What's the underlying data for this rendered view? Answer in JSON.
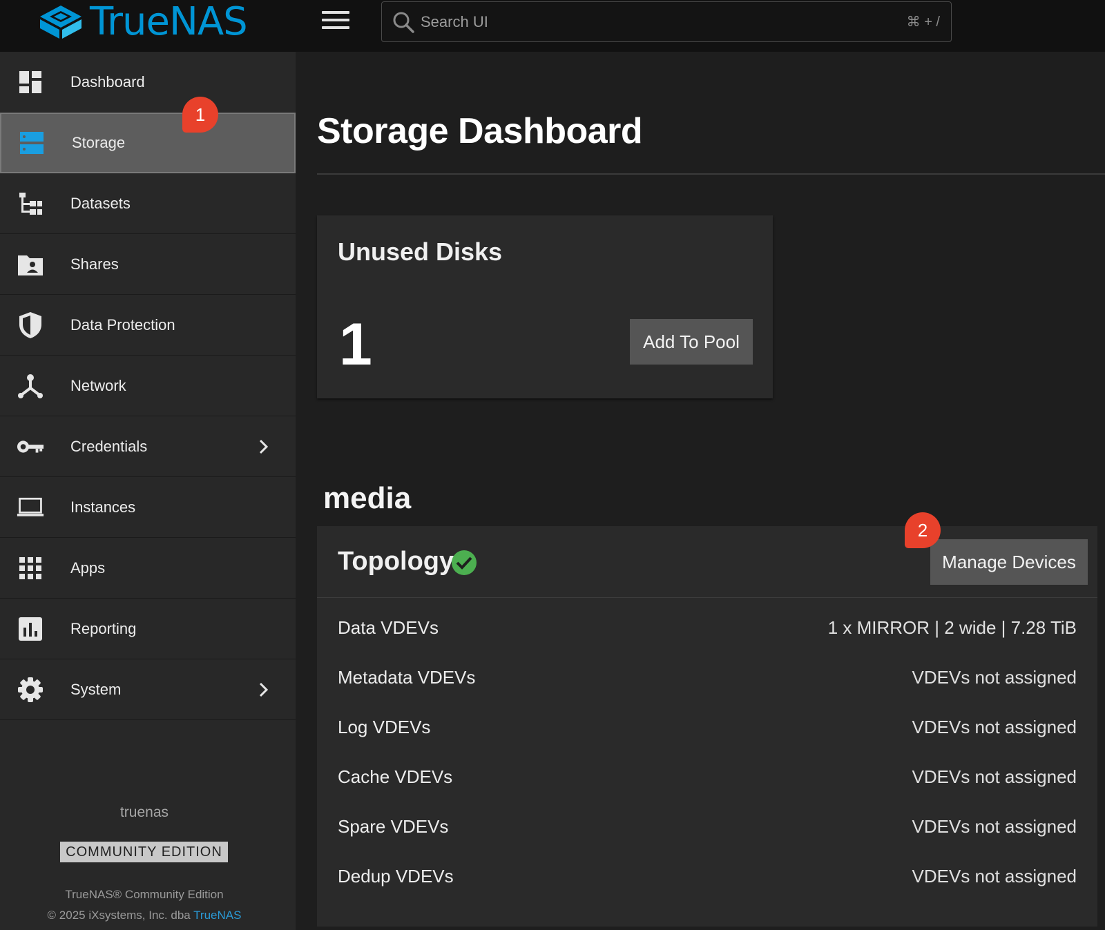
{
  "app": {
    "logo_text": "TrueNAS",
    "brand_color": "#0095d5"
  },
  "search": {
    "placeholder": "Search UI",
    "shortcut": "⌘ + /"
  },
  "sidebar": {
    "items": [
      {
        "label": "Dashboard",
        "icon": "dashboard-icon",
        "active": false
      },
      {
        "label": "Storage",
        "icon": "storage-icon",
        "active": true
      },
      {
        "label": "Datasets",
        "icon": "datasets-icon",
        "active": false
      },
      {
        "label": "Shares",
        "icon": "shares-folder-icon",
        "active": false
      },
      {
        "label": "Data Protection",
        "icon": "shield-icon",
        "active": false
      },
      {
        "label": "Network",
        "icon": "network-icon",
        "active": false
      },
      {
        "label": "Credentials",
        "icon": "key-icon",
        "active": false,
        "has_submenu": true
      },
      {
        "label": "Instances",
        "icon": "laptop-icon",
        "active": false
      },
      {
        "label": "Apps",
        "icon": "apps-grid-icon",
        "active": false
      },
      {
        "label": "Reporting",
        "icon": "bar-chart-icon",
        "active": false
      },
      {
        "label": "System",
        "icon": "gear-icon",
        "active": false,
        "has_submenu": true
      }
    ],
    "hostname": "truenas",
    "edition_badge": "COMMUNITY EDITION",
    "footer_line1": "TrueNAS® Community Edition",
    "footer_line2_prefix": "© 2025 iXsystems, Inc. dba ",
    "footer_link": "TrueNAS"
  },
  "annotations": {
    "badge1": "1",
    "badge2": "2",
    "badge_color": "#e8412b"
  },
  "main": {
    "page_title": "Storage Dashboard",
    "unused_disks": {
      "title": "Unused Disks",
      "count": "1",
      "button": "Add To Pool"
    },
    "pool": {
      "name": "media",
      "topology_title": "Topology",
      "status": "healthy",
      "status_color": "#4caf50",
      "manage_button": "Manage Devices",
      "vdevs": [
        {
          "label": "Data VDEVs",
          "value": "1 x MIRROR | 2 wide | 7.28 TiB"
        },
        {
          "label": "Metadata VDEVs",
          "value": "VDEVs not assigned"
        },
        {
          "label": "Log VDEVs",
          "value": "VDEVs not assigned"
        },
        {
          "label": "Cache VDEVs",
          "value": "VDEVs not assigned"
        },
        {
          "label": "Spare VDEVs",
          "value": "VDEVs not assigned"
        },
        {
          "label": "Dedup VDEVs",
          "value": "VDEVs not assigned"
        }
      ]
    }
  }
}
